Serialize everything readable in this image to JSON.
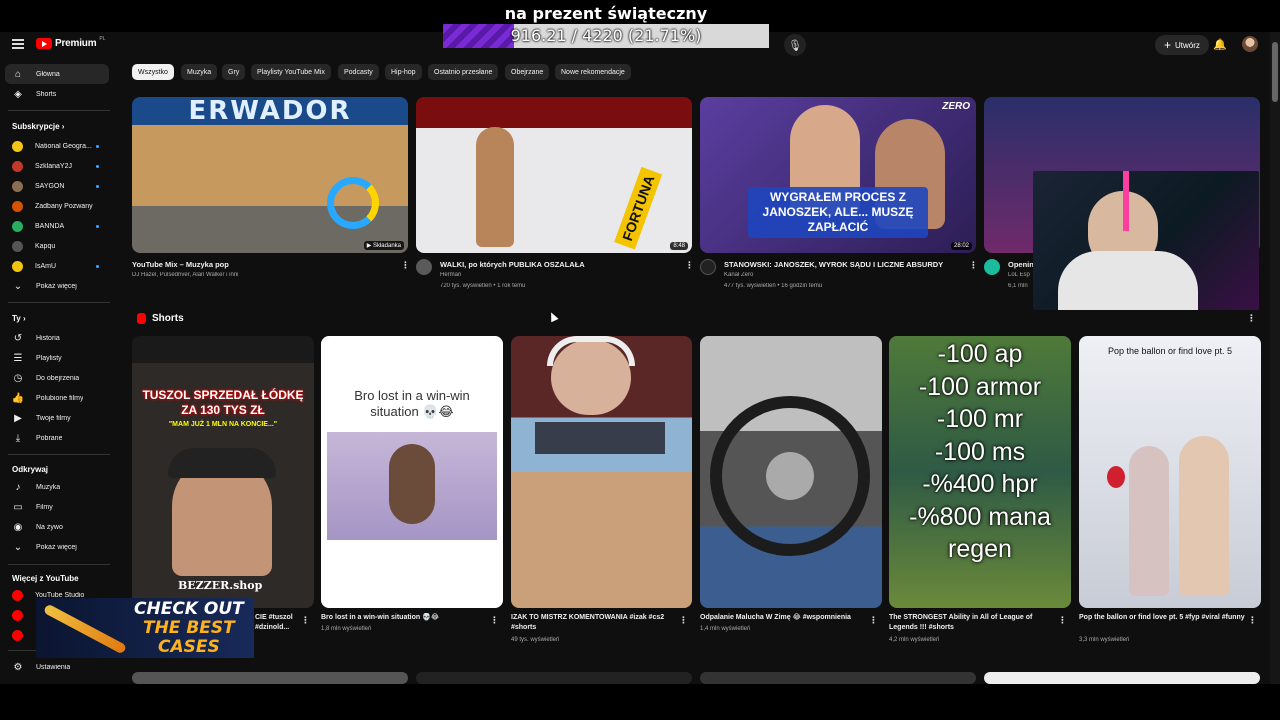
{
  "overlay": {
    "goal_title": "na prezent świąteczny",
    "goal_progress_text": "916.21 / 4220 (21.71%)",
    "goal_fraction": 0.2171,
    "ad_line1": "CHECK OUT",
    "ad_line2": "THE BEST",
    "ad_line3": "CASES"
  },
  "topbar": {
    "logo": "Premium",
    "logo_sup": "PL",
    "create_label": "Utwórz"
  },
  "sidebar": {
    "main": [
      {
        "label": "Główna",
        "icon": "home-icon"
      },
      {
        "label": "Shorts",
        "icon": "shorts-icon"
      }
    ],
    "subs_header": "Subskrypcje",
    "subscriptions": [
      {
        "label": "National Geogra...",
        "color": "#f5c518",
        "live": true
      },
      {
        "label": "SzklanaY2J",
        "color": "#c0392b",
        "live": true
      },
      {
        "label": "SAYGON",
        "color": "#8e6e53",
        "live": true
      },
      {
        "label": "Zadbany Pozwany",
        "color": "#d35400",
        "live": false
      },
      {
        "label": "BANNDA",
        "color": "#27ae60",
        "live": true
      },
      {
        "label": "Kapqu",
        "color": "#555555",
        "live": false
      },
      {
        "label": "IsAmU",
        "color": "#f1c40f",
        "live": true
      }
    ],
    "subs_more": "Pokaż więcej",
    "you_header": "Ty",
    "you_items": [
      {
        "label": "Historia",
        "icon": "history-icon"
      },
      {
        "label": "Playlisty",
        "icon": "playlist-icon"
      },
      {
        "label": "Do obejrzenia",
        "icon": "watch-later-icon"
      },
      {
        "label": "Polubione filmy",
        "icon": "like-icon"
      },
      {
        "label": "Twoje filmy",
        "icon": "your-videos-icon"
      },
      {
        "label": "Pobrane",
        "icon": "download-icon"
      }
    ],
    "explore_header": "Odkrywaj",
    "explore_items": [
      {
        "label": "Muzyka",
        "icon": "music-icon"
      },
      {
        "label": "Filmy",
        "icon": "film-icon"
      },
      {
        "label": "Na żywo",
        "icon": "live-icon"
      },
      {
        "label": "Pokaż więcej",
        "icon": "chevron-down-icon"
      }
    ],
    "more_header": "Więcej z YouTube",
    "more_items": [
      {
        "label": "YouTube Studio"
      }
    ],
    "settings": "Ustawienia"
  },
  "chips": [
    "Wszystko",
    "Muzyka",
    "Gry",
    "Playlisty YouTube Mix",
    "Podcasty",
    "Hip-hop",
    "Ostatnio przesłane",
    "Obejrzane",
    "Nowe rekomendacje"
  ],
  "videos": [
    {
      "title": "YouTube Mix – Muzyka pop",
      "channel": "DJ Hazel, Pulsedriver, Alan Walker i inni",
      "stats": "",
      "duration": "▶ Składanka",
      "thumb_text": "ERWADOR"
    },
    {
      "title": "WALKI, po których PUBLIKA OSZALAŁA",
      "channel": "Herman",
      "stats": "720 tys. wyświetleń • 1 rok temu",
      "duration": "8:48",
      "thumb_text": "FORTUNA"
    },
    {
      "title": "STANOWSKI: JANOSZEK, WYROK SĄDU I LICZNE ABSURDY",
      "channel": "Kanał Zero",
      "stats": "477 tys. wyświetleń • 16 godzin temu",
      "duration": "28:02",
      "thumb_text": "WYGRAŁEM PROCES Z JANOSZEK, ALE... MUSZĘ ZAPŁACIĆ",
      "thumb_badge": "ZERO"
    },
    {
      "title": "Openin",
      "channel": "LoL Esp",
      "stats": "6,1 mln",
      "duration": "",
      "thumb_text": ""
    }
  ],
  "shorts_header": "Shorts",
  "shorts": [
    {
      "title": "CIE #tuszol #dzinold...",
      "views": "",
      "thumb_text": "TUSZOL SPRZEDAŁ ŁÓDKĘ ZA 130 TYS ZŁ",
      "thumb_sub": "\"MAM JUŻ 1 MLN NA KONCIE...\"",
      "brand": "BEZZER.shop"
    },
    {
      "title": "Bro lost in a win-win situation 💀😂",
      "views": "1,8 mln wyświetleń",
      "thumb_text": "Bro lost in a win-win situation 💀😂"
    },
    {
      "title": "IZAK TO MISTRZ KOMENTOWANIA #izak #cs2 #shorts",
      "views": "49 tys. wyświetleń"
    },
    {
      "title": "Odpalanie Malucha W Zimę 😂 #wspomnienia",
      "views": "1,4 mln wyświetleń"
    },
    {
      "title": "The STRONGEST Ability in All of League of Legends !!! #shorts",
      "views": "4,2 mln wyświetleń",
      "thumb_lines": [
        "-100 ap",
        "-100 armor",
        "-100 mr",
        "-100 ms",
        "-%400 hpr",
        "-%800 mana",
        "regen"
      ]
    },
    {
      "title": "Pop the ballon or find love pt. 5 #fyp #viral #funny",
      "views": "3,3 mln wyświetleń",
      "thumb_text": "Pop the ballon or find love pt. 5"
    }
  ]
}
